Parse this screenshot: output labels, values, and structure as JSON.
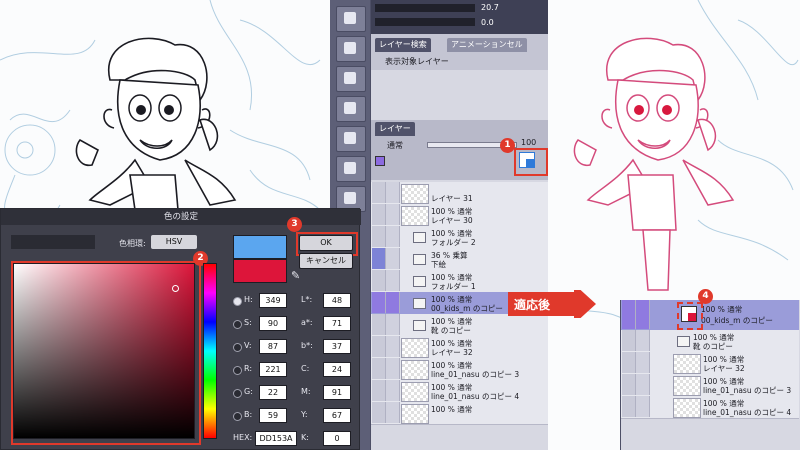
{
  "callouts": {
    "c1": "1",
    "c2": "2",
    "c3": "3",
    "c4": "4"
  },
  "toolbar": {
    "opacity_value": "20.7",
    "zero_value": "0.0"
  },
  "layer_panel": {
    "search_tab": "レイヤー検索",
    "anim_tab": "アニメーションセル",
    "target_layer": "表示対象レイヤー",
    "layer_tab": "レイヤー",
    "blend_mode": "通常",
    "opacity": "100",
    "rows": [
      {
        "l1": "",
        "l2": "レイヤー 31"
      },
      {
        "l1": "100 % 通常",
        "l2": "レイヤー 30"
      },
      {
        "l1": "100 % 通常",
        "l2": "フォルダー 2"
      },
      {
        "l1": "36 % 乗算",
        "l2": "下絵"
      },
      {
        "l1": "100 % 通常",
        "l2": "フォルダー 1"
      },
      {
        "l1": "100 % 通常",
        "l2": "00_kids_m のコピー"
      },
      {
        "l1": "100 % 通常",
        "l2": "靴 のコピー"
      },
      {
        "l1": "100 % 通常",
        "l2": "レイヤー 32"
      },
      {
        "l1": "100 % 通常",
        "l2": "line_01_nasu のコピー 3"
      },
      {
        "l1": "100 % 通常",
        "l2": "line_01_nasu のコピー 4"
      },
      {
        "l1": "100 % 通常",
        "l2": ""
      }
    ]
  },
  "color_dialog": {
    "title": "色の設定",
    "hue_ring_label": "色相環:",
    "hue_ring_value": "HSV",
    "ok": "OK",
    "cancel": "キャンセル",
    "base_color": "#5ba6ef",
    "new_color": "#dd153a",
    "fields": {
      "H": "349",
      "S": "90",
      "V": "87",
      "R": "221",
      "G": "22",
      "B": "59",
      "Lstar": "48",
      "astar": "71",
      "bstar": "37",
      "C": "24",
      "M": "91",
      "Y": "67",
      "K": "0",
      "HEX": "DD153A"
    },
    "labels": {
      "H": "H:",
      "S": "S:",
      "V": "V:",
      "R": "R:",
      "G": "G:",
      "B": "B:",
      "Lstar": "L*:",
      "astar": "a*:",
      "bstar": "b*:",
      "C": "C:",
      "M": "M:",
      "Y": "Y:",
      "K": "K:",
      "HEX": "HEX:"
    }
  },
  "after_label": "適応後",
  "after_panel": {
    "rows": [
      {
        "l1": "100 % 通常",
        "l2": "00_kids_m のコピー"
      },
      {
        "l1": "100 % 通常",
        "l2": "靴 のコピー"
      },
      {
        "l1": "100 % 通常",
        "l2": "レイヤー 32"
      },
      {
        "l1": "100 % 通常",
        "l2": "line_01_nasu のコピー 3"
      },
      {
        "l1": "100 % 通常",
        "l2": "line_01_nasu のコピー 4"
      }
    ]
  }
}
